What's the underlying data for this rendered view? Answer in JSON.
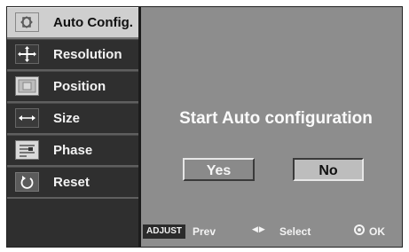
{
  "menu": {
    "items": [
      {
        "label": "Auto Config.",
        "icon": "auto-config-icon",
        "active": true
      },
      {
        "label": "Resolution",
        "icon": "resolution-icon",
        "active": false
      },
      {
        "label": "Position",
        "icon": "position-icon",
        "active": false
      },
      {
        "label": "Size",
        "icon": "size-icon",
        "active": false
      },
      {
        "label": "Phase",
        "icon": "phase-icon",
        "active": false
      },
      {
        "label": "Reset",
        "icon": "reset-icon",
        "active": false
      }
    ]
  },
  "dialog": {
    "title": "Start Auto configuration",
    "yes_label": "Yes",
    "no_label": "No",
    "selected": "No"
  },
  "footer": {
    "adjust_key": "ADJUST",
    "prev_label": "Prev",
    "select_label": "Select",
    "ok_label": "OK"
  },
  "colors": {
    "panel": "#8d8d8d",
    "sidebar": "#2f2f2f",
    "active_item": "#cfcfcf"
  }
}
